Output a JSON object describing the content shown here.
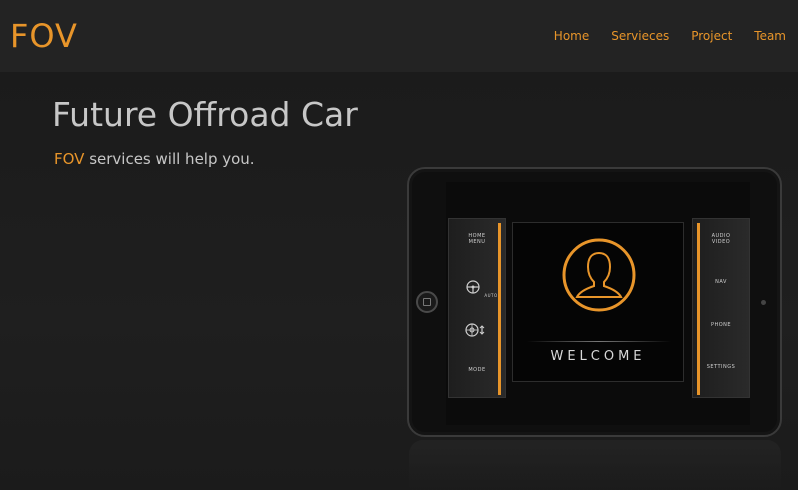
{
  "header": {
    "logo": "FOV",
    "nav": [
      "Home",
      "Servieces",
      "Project",
      "Team"
    ]
  },
  "hero": {
    "title": "Future Offroad Car",
    "subtitle_accent": "FOV",
    "subtitle_rest": " services will help you."
  },
  "tablet": {
    "left_panel": {
      "home_menu": "HOME\nMENU",
      "auto_label": "AUTO",
      "mode": "MODE"
    },
    "right_panel": {
      "audio_video": "AUDIO\nVIDEO",
      "nav": "NAV",
      "phone": "PHONE",
      "settings": "SETTINGS"
    },
    "welcome": "WELCOME"
  },
  "colors": {
    "accent": "#e8952a",
    "background": "#1d1d1d",
    "header_bg": "#232323",
    "text": "#c7c7c7"
  }
}
